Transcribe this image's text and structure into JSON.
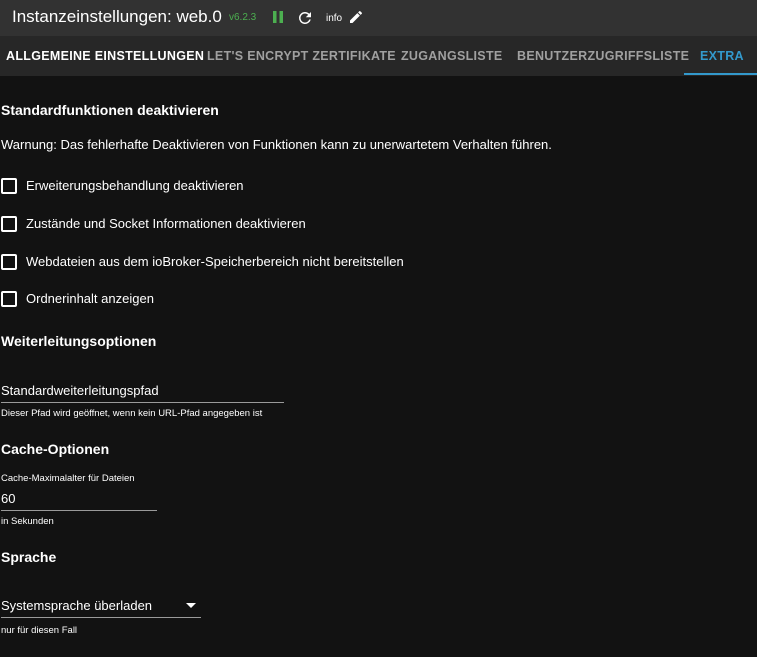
{
  "header": {
    "title": "Instanzeinstellungen: web.0",
    "version": "v6.2.3",
    "info_label": "info",
    "version_color": "#4caf50",
    "icons": [
      "pause-icon",
      "reload-icon",
      "pencil-icon"
    ]
  },
  "tabs": [
    {
      "label": "Allgemeine Einstellungen"
    },
    {
      "label": "Let's Encrypt Zertifikate"
    },
    {
      "label": "Zugangsliste"
    },
    {
      "label": "Benutzerzugriffsliste"
    },
    {
      "label": "Extra"
    }
  ],
  "accent_color": "#3399cc",
  "sections": {
    "standard": {
      "title": "Standardfunktionen deaktivieren",
      "warning": "Warnung: Das fehlerhafte Deaktivieren von Funktionen kann zu unerwartetem Verhalten führen.",
      "checkboxes": [
        {
          "label": "Erweiterungsbehandlung deaktivieren",
          "checked": false
        },
        {
          "label": "Zustände und Socket Informationen deaktivieren",
          "checked": false
        },
        {
          "label": "Webdateien aus dem ioBroker-Speicherbereich nicht bereitstellen",
          "checked": false
        },
        {
          "label": "Ordnerinhalt anzeigen",
          "checked": false
        }
      ]
    },
    "redirect": {
      "title": "Weiterleitungsoptionen",
      "field_value": "Standardweiterleitungspfad",
      "helper": "Dieser Pfad wird geöffnet, wenn kein URL-Pfad angegeben ist"
    },
    "cache": {
      "title": "Cache-Optionen",
      "field_label": "Cache-Maximalalter für Dateien",
      "field_value": "60",
      "helper": "in Sekunden"
    },
    "language": {
      "title": "Sprache",
      "select_value": "Systemsprache überladen",
      "helper": "nur für diesen Fall"
    }
  }
}
